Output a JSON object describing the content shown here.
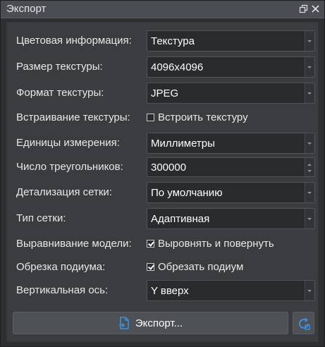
{
  "window": {
    "title": "Экспорт",
    "restore_icon": "restore-icon",
    "close_icon": "close-icon"
  },
  "form": {
    "color_info": {
      "label": "Цветовая информация:",
      "value": "Текстура"
    },
    "texture_size": {
      "label": "Размер текстуры:",
      "value": "4096x4096"
    },
    "texture_format": {
      "label": "Формат текстуры:",
      "value": "JPEG"
    },
    "texture_embed": {
      "label": "Встраивание текстуры:",
      "checkbox_label": "Встроить текстуру",
      "checked": false
    },
    "units": {
      "label": "Единицы измерения:",
      "value": "Миллиметры"
    },
    "triangle_count": {
      "label": "Число треугольников:",
      "value": "300000"
    },
    "mesh_detail": {
      "label": "Детализация сетки:",
      "value": "По умолчанию"
    },
    "mesh_type": {
      "label": "Тип сетки:",
      "value": "Адаптивная"
    },
    "model_align": {
      "label": "Выравнивание модели:",
      "checkbox_label": "Выровнять и повернуть",
      "checked": true
    },
    "podium_trim": {
      "label": "Обрезка подиума:",
      "checkbox_label": "Обрезать подиум",
      "checked": true
    },
    "vertical_axis": {
      "label": "Вертикальная ось:",
      "value": "Y вверх"
    }
  },
  "actions": {
    "export_label": "Экспорт...",
    "export_icon": "export-file-icon",
    "side_icon": "refresh-settings-icon"
  },
  "colors": {
    "accent_blue": "#3b8fe0",
    "background": "#2e2f31",
    "panel": "#3a3c3f"
  }
}
